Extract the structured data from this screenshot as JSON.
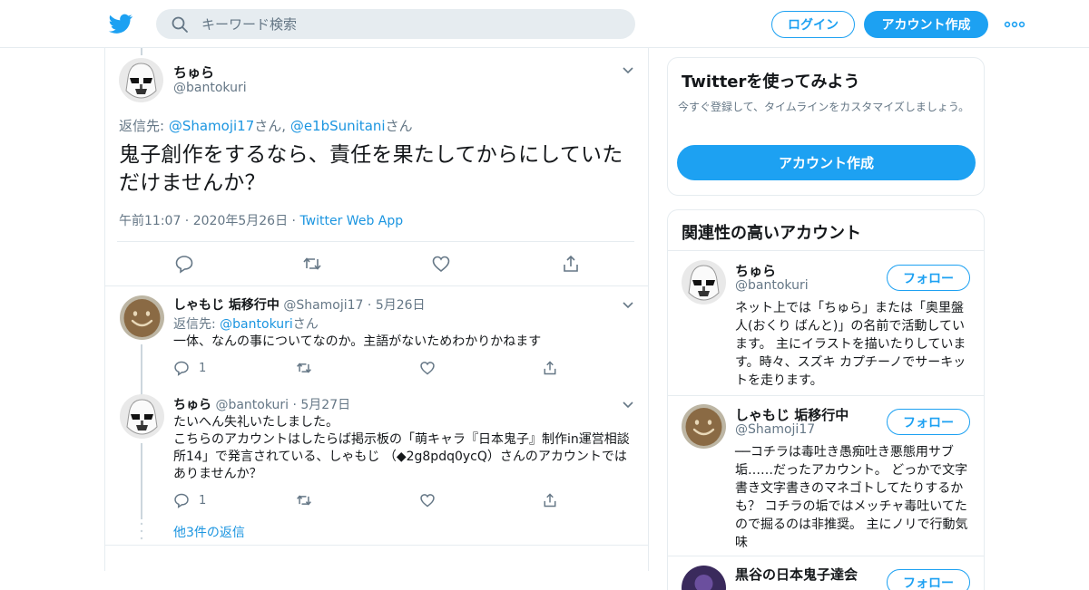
{
  "header": {
    "search_placeholder": "キーワード検索",
    "login_label": "ログイン",
    "signup_label": "アカウント作成"
  },
  "main_tweet": {
    "name": "ちゅら",
    "handle": "@bantokuri",
    "reply_prefix": "返信先: ",
    "reply_user1": "@Shamoji17",
    "reply_sep": "さん, ",
    "reply_user2": "@e1bSunitani",
    "reply_suffix": "さん",
    "text": "鬼子創作をするなら、責任を果たしてからにしていただけませんか？",
    "time": "午前11:07",
    "dot": " · ",
    "date": "2020年5月26日",
    "source": "Twitter Web App"
  },
  "replies": [
    {
      "name": "しゃもじ 垢移行中",
      "handle": "@Shamoji17",
      "date": "· 5月26日",
      "reply_prefix": "返信先: ",
      "reply_user": "@bantokuri",
      "reply_suffix": "さん",
      "text": "一体、なんの事についてなのか。主語がないためわかりかねます",
      "reply_count": "1"
    },
    {
      "name": "ちゅら",
      "handle": "@bantokuri",
      "date": "· 5月27日",
      "text_line1": "たいへん失礼いたしました。",
      "text_line2": "こちらのアカウントはしたらば掲示板の「萌キャラ『日本鬼子』制作in運営相談所14」で発言されている、しゃもじ （◆2g8pdq0ycQ）さんのアカウントではありませんか？",
      "reply_count": "1"
    }
  ],
  "more_replies": "他3件の返信",
  "sidebar": {
    "signup_card": {
      "title": "Twitterを使ってみよう",
      "subtitle": "今すぐ登録して、タイムラインをカスタマイズしましょう。",
      "button": "アカウント作成"
    },
    "related": {
      "title": "関連性の高いアカウント",
      "follow_label": "フォロー",
      "accounts": [
        {
          "name": "ちゅら",
          "handle": "@bantokuri",
          "bio": "ネット上では「ちゅら」または「奥里盤人(おくり ばんと)」の名前で活動しています。 主にイラストを描いたりしています。時々、スズキ カプチーノでサーキットを走ります。"
        },
        {
          "name": "しゃもじ 垢移行中",
          "handle": "@Shamoji17",
          "bio": "──コチラは毒吐き愚痴吐き悪態用サブ垢……だったアカウント。 どっかで文字書き文字書きのマネゴトしてたりするかも？ コチラの垢ではメッチャ毒吐いてたので掘るのは非推奨。 主にノリで行動気味"
        },
        {
          "name": "黒谷の日本鬼子達会"
        }
      ]
    }
  },
  "colors": {
    "brand": "#1da1f2",
    "link": "#1b95e0",
    "muted": "#657786",
    "border": "#e6ecf0"
  },
  "icons": [
    "twitter-bird-icon",
    "search-icon",
    "more-dots-icon",
    "chevron-down-icon",
    "reply-icon",
    "retweet-icon",
    "like-icon",
    "share-icon"
  ]
}
